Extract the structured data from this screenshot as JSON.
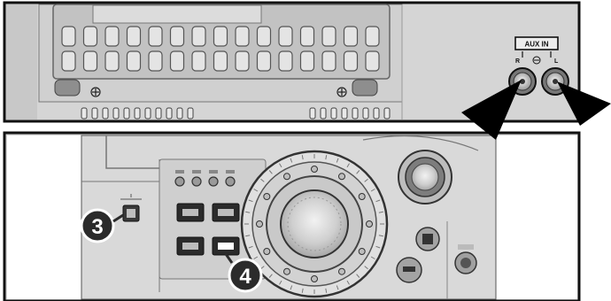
{
  "diagram": {
    "aux_panel": {
      "label": "AUX IN",
      "left_channel_label": "R",
      "right_channel_label": "L"
    },
    "callouts": [
      {
        "number": "3"
      },
      {
        "number": "4"
      }
    ]
  },
  "colors": {
    "panel_fill": "#d4d4d4",
    "panel_border": "#111111",
    "arrow": "#000000",
    "callout_fill": "#2b2b2b"
  }
}
